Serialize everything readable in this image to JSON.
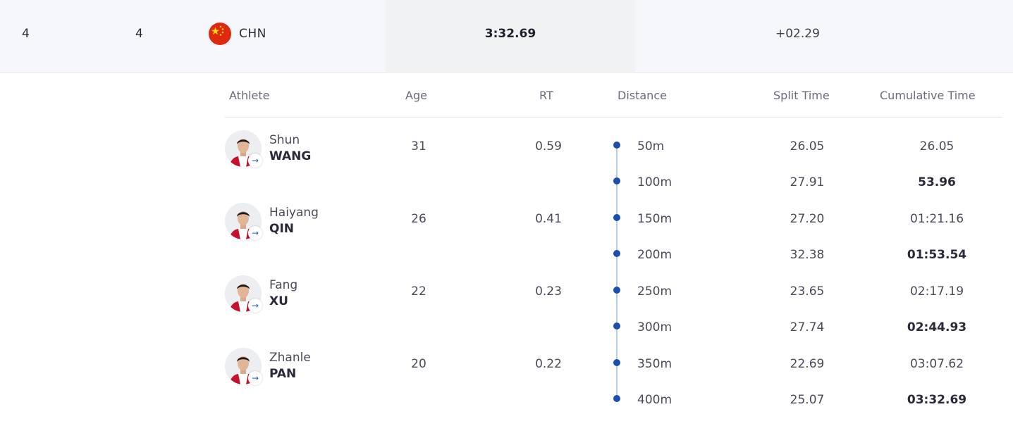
{
  "summary": {
    "rank": "4",
    "lane": "4",
    "country": "CHN",
    "final_time": "3:32.69",
    "behind": "+02.29"
  },
  "headers": {
    "athlete": "Athlete",
    "age": "Age",
    "rt": "RT",
    "distance": "Distance",
    "split": "Split Time",
    "cumulative": "Cumulative Time"
  },
  "athletes": [
    {
      "first": "Shun",
      "last": "WANG",
      "age": "31",
      "rt": "0.59"
    },
    {
      "first": "Haiyang",
      "last": "QIN",
      "age": "26",
      "rt": "0.41"
    },
    {
      "first": "Fang",
      "last": "XU",
      "age": "22",
      "rt": "0.23"
    },
    {
      "first": "Zhanle",
      "last": "PAN",
      "age": "20",
      "rt": "0.22"
    }
  ],
  "splits": [
    {
      "distance": "50m",
      "split": "26.05",
      "cumulative": "26.05"
    },
    {
      "distance": "100m",
      "split": "27.91",
      "cumulative": "53.96"
    },
    {
      "distance": "150m",
      "split": "27.20",
      "cumulative": "01:21.16"
    },
    {
      "distance": "200m",
      "split": "32.38",
      "cumulative": "01:53.54"
    },
    {
      "distance": "250m",
      "split": "23.65",
      "cumulative": "02:17.19"
    },
    {
      "distance": "300m",
      "split": "27.74",
      "cumulative": "02:44.93"
    },
    {
      "distance": "350m",
      "split": "22.69",
      "cumulative": "03:07.62"
    },
    {
      "distance": "400m",
      "split": "25.07",
      "cumulative": "03:32.69"
    }
  ],
  "icons": {
    "flag": "china-flag-icon",
    "avatar": "athlete-avatar",
    "link": "arrow-right-icon",
    "timeline": "timeline-dot-icon"
  },
  "colors": {
    "accent": "#1a4fb0",
    "flag_red": "#de2910",
    "flag_yellow": "#ffde00"
  }
}
